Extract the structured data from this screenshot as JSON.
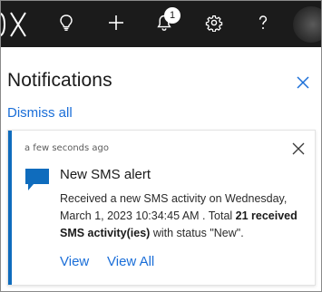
{
  "topbar": {
    "logo_fragment": "X",
    "icons": [
      "lightbulb-icon",
      "plus-icon",
      "bell-icon",
      "gear-icon",
      "help-icon",
      "avatar"
    ],
    "notification_badge": "1",
    "background": "#1b1b1b"
  },
  "panel": {
    "title": "Notifications",
    "dismiss_all": "Dismiss all"
  },
  "notification": {
    "time": "a few seconds ago",
    "title": "New SMS alert",
    "body_prefix": "Received a new SMS activity on Wednesday, March 1, 2023 10:34:45 AM . Total ",
    "body_bold": "21 received SMS activity(ies)",
    "body_suffix": " with status \"New\".",
    "actions": [
      "View",
      "View All"
    ],
    "accent_color": "#0f6cbd",
    "link_color": "#1a6ed8"
  }
}
